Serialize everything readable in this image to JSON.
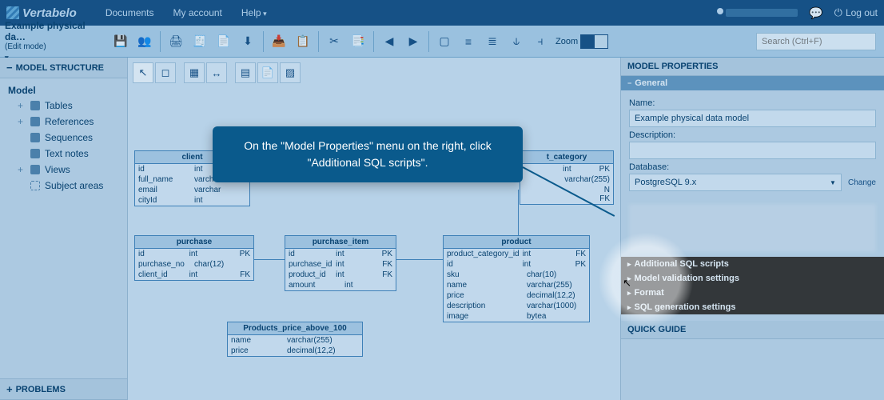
{
  "brand": "Vertabelo",
  "topnav": {
    "documents": "Documents",
    "my_account": "My account",
    "help": "Help",
    "logout": "Log out"
  },
  "doc": {
    "title": "Example physical da…",
    "mode": "(Edit mode)"
  },
  "zoom_label": "Zoom",
  "search_placeholder": "Search (Ctrl+F)",
  "left_panel": {
    "title": "MODEL STRUCTURE",
    "root": "Model",
    "items": [
      "Tables",
      "References",
      "Sequences",
      "Text notes",
      "Views",
      "Subject areas"
    ],
    "problems": "PROBLEMS"
  },
  "entities": {
    "client": {
      "title": "client",
      "rows": [
        {
          "c1": "id",
          "c2": "int",
          "c3": ""
        },
        {
          "c1": "full_name",
          "c2": "varchar",
          "c3": ""
        },
        {
          "c1": "email",
          "c2": "varchar",
          "c3": ""
        },
        {
          "c1": "cityId",
          "c2": "int",
          "c3": ""
        }
      ]
    },
    "t_category": {
      "title": "t_category",
      "rows": [
        {
          "c1": "",
          "c2": "int",
          "c3": "PK"
        },
        {
          "c1": "",
          "c2": "varchar(255)",
          "c3": ""
        },
        {
          "c1": "",
          "c2": "",
          "c3": "N FK"
        }
      ]
    },
    "purchase": {
      "title": "purchase",
      "rows": [
        {
          "c1": "id",
          "c2": "int",
          "c3": "PK"
        },
        {
          "c1": "purchase_no",
          "c2": "char(12)",
          "c3": ""
        },
        {
          "c1": "client_id",
          "c2": "int",
          "c3": "FK"
        }
      ]
    },
    "purchase_item": {
      "title": "purchase_item",
      "rows": [
        {
          "c1": "id",
          "c2": "int",
          "c3": "PK"
        },
        {
          "c1": "purchase_id",
          "c2": "int",
          "c3": "FK"
        },
        {
          "c1": "product_id",
          "c2": "int",
          "c3": "FK"
        },
        {
          "c1": "amount",
          "c2": "int",
          "c3": ""
        }
      ]
    },
    "product": {
      "title": "product",
      "rows": [
        {
          "c1": "product_category_id",
          "c2": "int",
          "c3": "FK"
        },
        {
          "c1": "id",
          "c2": "int",
          "c3": "PK"
        },
        {
          "c1": "sku",
          "c2": "char(10)",
          "c3": ""
        },
        {
          "c1": "name",
          "c2": "varchar(255)",
          "c3": ""
        },
        {
          "c1": "price",
          "c2": "decimal(12,2)",
          "c3": ""
        },
        {
          "c1": "description",
          "c2": "varchar(1000)",
          "c3": ""
        },
        {
          "c1": "image",
          "c2": "bytea",
          "c3": ""
        }
      ]
    },
    "products_price": {
      "title": "Products_price_above_100",
      "rows": [
        {
          "c1": "name",
          "c2": "varchar(255)",
          "c3": ""
        },
        {
          "c1": "price",
          "c2": "decimal(12,2)",
          "c3": ""
        }
      ]
    }
  },
  "right_panel": {
    "title": "MODEL PROPERTIES",
    "general": "General",
    "name_label": "Name:",
    "name_value": "Example physical data model",
    "desc_label": "Description:",
    "db_label": "Database:",
    "db_value": "PostgreSQL 9.x",
    "change": "Change",
    "sections": {
      "sql": "Additional SQL scripts",
      "validation": "Model validation settings",
      "format": "Format",
      "generation": "SQL generation settings"
    },
    "quick_guide": "QUICK GUIDE"
  },
  "callout_text": "On the \"Model Properties\" menu on the right, click \"Additional SQL scripts\"."
}
